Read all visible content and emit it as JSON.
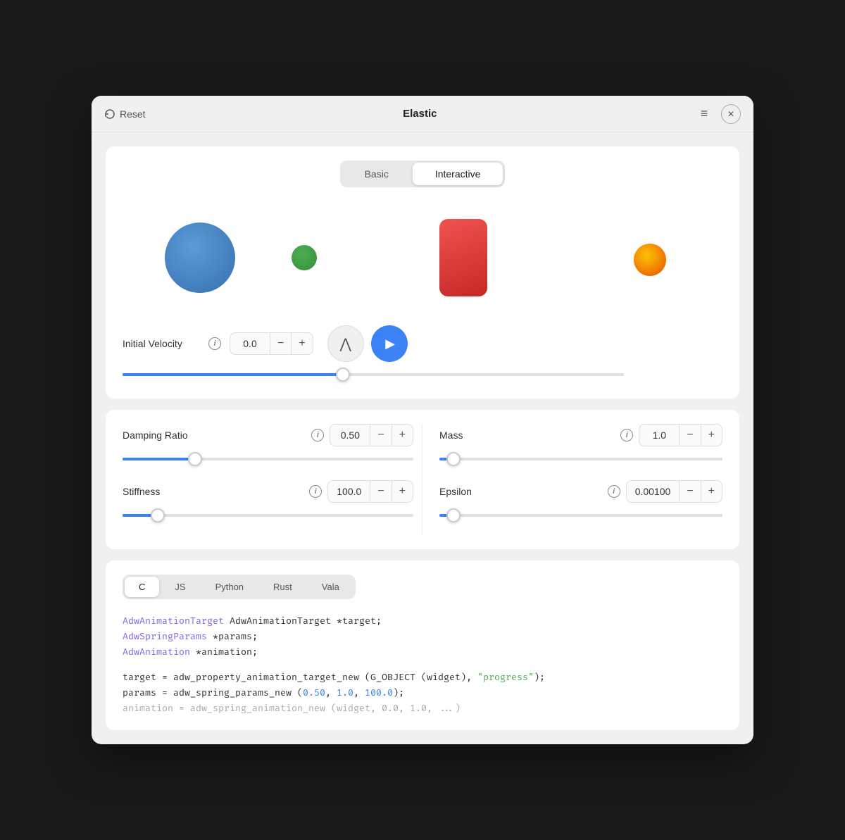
{
  "window": {
    "title": "Elastic",
    "reset_label": "Reset"
  },
  "tabs": {
    "basic_label": "Basic",
    "interactive_label": "Interactive",
    "active": "Interactive"
  },
  "initial_velocity": {
    "label": "Initial Velocity",
    "value": "0.0",
    "slider_fill_pct": 44
  },
  "params": {
    "damping_ratio": {
      "label": "Damping Ratio",
      "value": "0.50",
      "slider_fill_pct": 25
    },
    "mass": {
      "label": "Mass",
      "value": "1.0",
      "slider_fill_pct": 5
    },
    "stiffness": {
      "label": "Stiffness",
      "value": "100.0",
      "slider_fill_pct": 12
    },
    "epsilon": {
      "label": "Epsilon",
      "value": "0.00100",
      "slider_fill_pct": 5
    }
  },
  "code_tabs": {
    "tabs": [
      "C",
      "JS",
      "Python",
      "Rust",
      "Vala"
    ],
    "active": "C"
  },
  "code": {
    "line1": "AdwAnimationTarget *target;",
    "line2": "AdwSpringParams *params;",
    "line3": "AdwAnimation *animation;",
    "line4": "",
    "line5_start": "target = adw_property_animation_target_new (G_OBJECT (widget), ",
    "line5_string": "\"progress\"",
    "line5_end": ");",
    "line6_start": "params = adw_spring_params_new (",
    "line6_num1": "0.50",
    "line6_comma1": ", ",
    "line6_num2": "1.0",
    "line6_comma2": ", ",
    "line6_num3": "100.0",
    "line6_end": ");"
  },
  "icons": {
    "reset": "↺",
    "menu": "≡",
    "close": "✕",
    "info": "i",
    "minus": "−",
    "plus": "+",
    "play": "▶",
    "wave": "∧"
  }
}
